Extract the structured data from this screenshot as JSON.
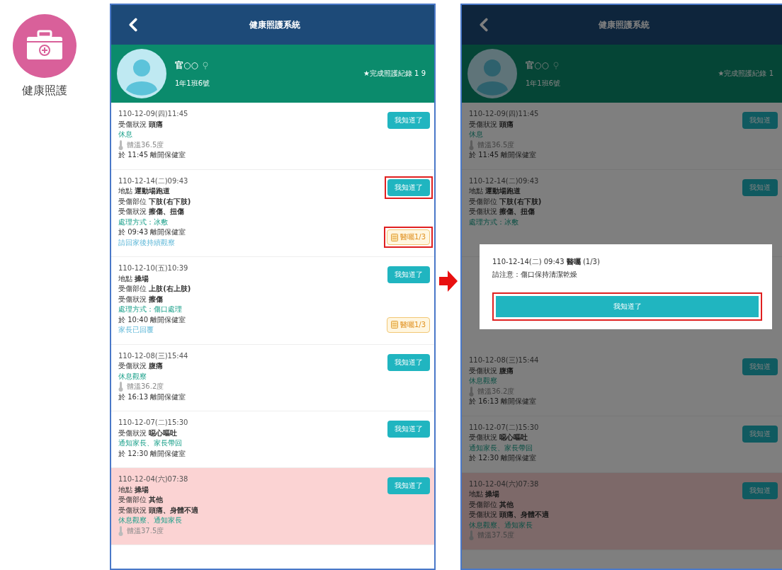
{
  "app_icon": {
    "label": "健康照護"
  },
  "screens": [
    {
      "title": "健康照護系統",
      "dimmed": false,
      "student": {
        "name": "官○○",
        "class": "1年1班6號",
        "summary": "★完成照護紀錄 1 9"
      },
      "records": [
        {
          "kind": "record",
          "alert": false,
          "button": {
            "label": "我知道了",
            "highlighted": false
          },
          "lines": [
            {
              "kind": "date",
              "text": "110-12-09(四)11:45"
            },
            {
              "kind": "detail",
              "text": "受傷狀況 **頭痛**"
            },
            {
              "kind": "note",
              "text": "休息"
            },
            {
              "kind": "temp",
              "text": "體溫36.5度"
            },
            {
              "kind": "leave",
              "text": "於 11:45 離開保健室"
            }
          ]
        },
        {
          "kind": "record",
          "alert": false,
          "button": {
            "label": "我知道了",
            "highlighted": true
          },
          "badge": {
            "text": "醫囑1/3",
            "highlighted": true
          },
          "lines": [
            {
              "kind": "date",
              "text": "110-12-14(二)09:43"
            },
            {
              "kind": "detail",
              "text": "地點 **運動場跑道**"
            },
            {
              "kind": "detail",
              "text": "受傷部位 **下肢(右下肢)**"
            },
            {
              "kind": "detail",
              "text": "受傷狀況 **擦傷、扭傷**"
            },
            {
              "kind": "note",
              "text": "處理方式：冰敷"
            },
            {
              "kind": "leave",
              "text": "於 09:43 離開保健室"
            },
            {
              "kind": "reply",
              "text": "請回家後持續觀察"
            }
          ]
        },
        {
          "kind": "record",
          "alert": false,
          "button": {
            "label": "我知道了",
            "highlighted": false
          },
          "badge": {
            "text": "醫囑1/3",
            "highlighted": false
          },
          "lines": [
            {
              "kind": "date",
              "text": "110-12-10(五)10:39"
            },
            {
              "kind": "detail",
              "text": "地點 **操場**"
            },
            {
              "kind": "detail",
              "text": "受傷部位 **上肢(右上肢)**"
            },
            {
              "kind": "detail",
              "text": "受傷狀況 **擦傷**"
            },
            {
              "kind": "note",
              "text": "處理方式：傷口處理"
            },
            {
              "kind": "leave",
              "text": "於 10:40 離開保健室"
            },
            {
              "kind": "reply",
              "text": "家長已回覆"
            }
          ]
        },
        {
          "kind": "record",
          "alert": false,
          "button": {
            "label": "我知道了",
            "highlighted": false
          },
          "lines": [
            {
              "kind": "date",
              "text": "110-12-08(三)15:44"
            },
            {
              "kind": "detail",
              "text": "受傷狀況 **腹痛**"
            },
            {
              "kind": "note",
              "text": "休息觀察"
            },
            {
              "kind": "temp",
              "text": "體溫36.2度"
            },
            {
              "kind": "leave",
              "text": "於 16:13 離開保健室"
            }
          ]
        },
        {
          "kind": "record",
          "alert": false,
          "button": {
            "label": "我知道了",
            "highlighted": false
          },
          "lines": [
            {
              "kind": "date",
              "text": "110-12-07(二)15:30"
            },
            {
              "kind": "detail",
              "text": "受傷狀況 **噁心嘔吐**"
            },
            {
              "kind": "note",
              "text": "通知家長、家長帶回"
            },
            {
              "kind": "leave",
              "text": "於 12:30 離開保健室"
            }
          ]
        },
        {
          "kind": "record",
          "alert": true,
          "button": {
            "label": "我知道了",
            "highlighted": false
          },
          "lines": [
            {
              "kind": "date",
              "text": "110-12-04(六)07:38"
            },
            {
              "kind": "detail",
              "text": "地點 **操場**"
            },
            {
              "kind": "detail",
              "text": "受傷部位 **其他**"
            },
            {
              "kind": "detail",
              "text": "受傷狀況 **頭痛、身體不適**"
            },
            {
              "kind": "note",
              "text": "休息觀察、通知家長"
            },
            {
              "kind": "temp",
              "text": "體溫37.5度"
            }
          ]
        }
      ]
    },
    {
      "title": "健康照護系統",
      "dimmed": true,
      "student": {
        "name": "官○○",
        "class": "1年1班6號",
        "summary": "★完成照護紀錄 1"
      },
      "modal": {
        "heading": "110-12-14(二) 09:43 **醫囑** (1/3)",
        "message": "請注意：傷口保持清潔乾燥",
        "button": {
          "label": "我知道了",
          "highlighted": true
        }
      },
      "records": [
        {
          "kind": "record",
          "alert": false,
          "button": {
            "label": "我知道",
            "highlighted": false
          },
          "lines": [
            {
              "kind": "date",
              "text": "110-12-09(四)11:45"
            },
            {
              "kind": "detail",
              "text": "受傷狀況 **頭痛**"
            },
            {
              "kind": "note",
              "text": "休息"
            },
            {
              "kind": "temp",
              "text": "體溫36.5度"
            },
            {
              "kind": "leave",
              "text": "於 11:45 離開保健室"
            }
          ]
        },
        {
          "kind": "partial",
          "alert": false,
          "button": {
            "label": "我知道",
            "highlighted": false
          },
          "lines": [
            {
              "kind": "date",
              "text": "110-12-14(二)09:43"
            },
            {
              "kind": "detail",
              "text": "地點 **運動場跑道**"
            },
            {
              "kind": "detail",
              "text": "受傷部位 **下肢(右下肢)**"
            },
            {
              "kind": "detail",
              "text": "受傷狀況 **擦傷、扭傷**"
            },
            {
              "kind": "note",
              "text": "處理方式：冰敷"
            }
          ]
        },
        {
          "kind": "covered"
        },
        {
          "kind": "record",
          "alert": false,
          "button": {
            "label": "我知道",
            "highlighted": false
          },
          "lines": [
            {
              "kind": "date",
              "text": "110-12-08(三)15:44"
            },
            {
              "kind": "detail",
              "text": "受傷狀況 **腹痛**"
            },
            {
              "kind": "note",
              "text": "休息觀察"
            },
            {
              "kind": "temp",
              "text": "體溫36.2度"
            },
            {
              "kind": "leave",
              "text": "於 16:13 離開保健室"
            }
          ]
        },
        {
          "kind": "record",
          "alert": false,
          "button": {
            "label": "我知道",
            "highlighted": false
          },
          "lines": [
            {
              "kind": "date",
              "text": "110-12-07(二)15:30"
            },
            {
              "kind": "detail",
              "text": "受傷狀況 **噁心嘔吐**"
            },
            {
              "kind": "note",
              "text": "通知家長、家長帶回"
            },
            {
              "kind": "leave",
              "text": "於 12:30 離開保健室"
            }
          ]
        },
        {
          "kind": "record",
          "alert": true,
          "button": {
            "label": "我知道",
            "highlighted": false
          },
          "lines": [
            {
              "kind": "date",
              "text": "110-12-04(六)07:38"
            },
            {
              "kind": "detail",
              "text": "地點 **操場**"
            },
            {
              "kind": "detail",
              "text": "受傷部位 **其他**"
            },
            {
              "kind": "detail",
              "text": "受傷狀況 **頭痛、身體不適**"
            },
            {
              "kind": "note",
              "text": "休息觀察、通知家長"
            },
            {
              "kind": "temp",
              "text": "體溫37.5度"
            }
          ]
        }
      ]
    }
  ]
}
